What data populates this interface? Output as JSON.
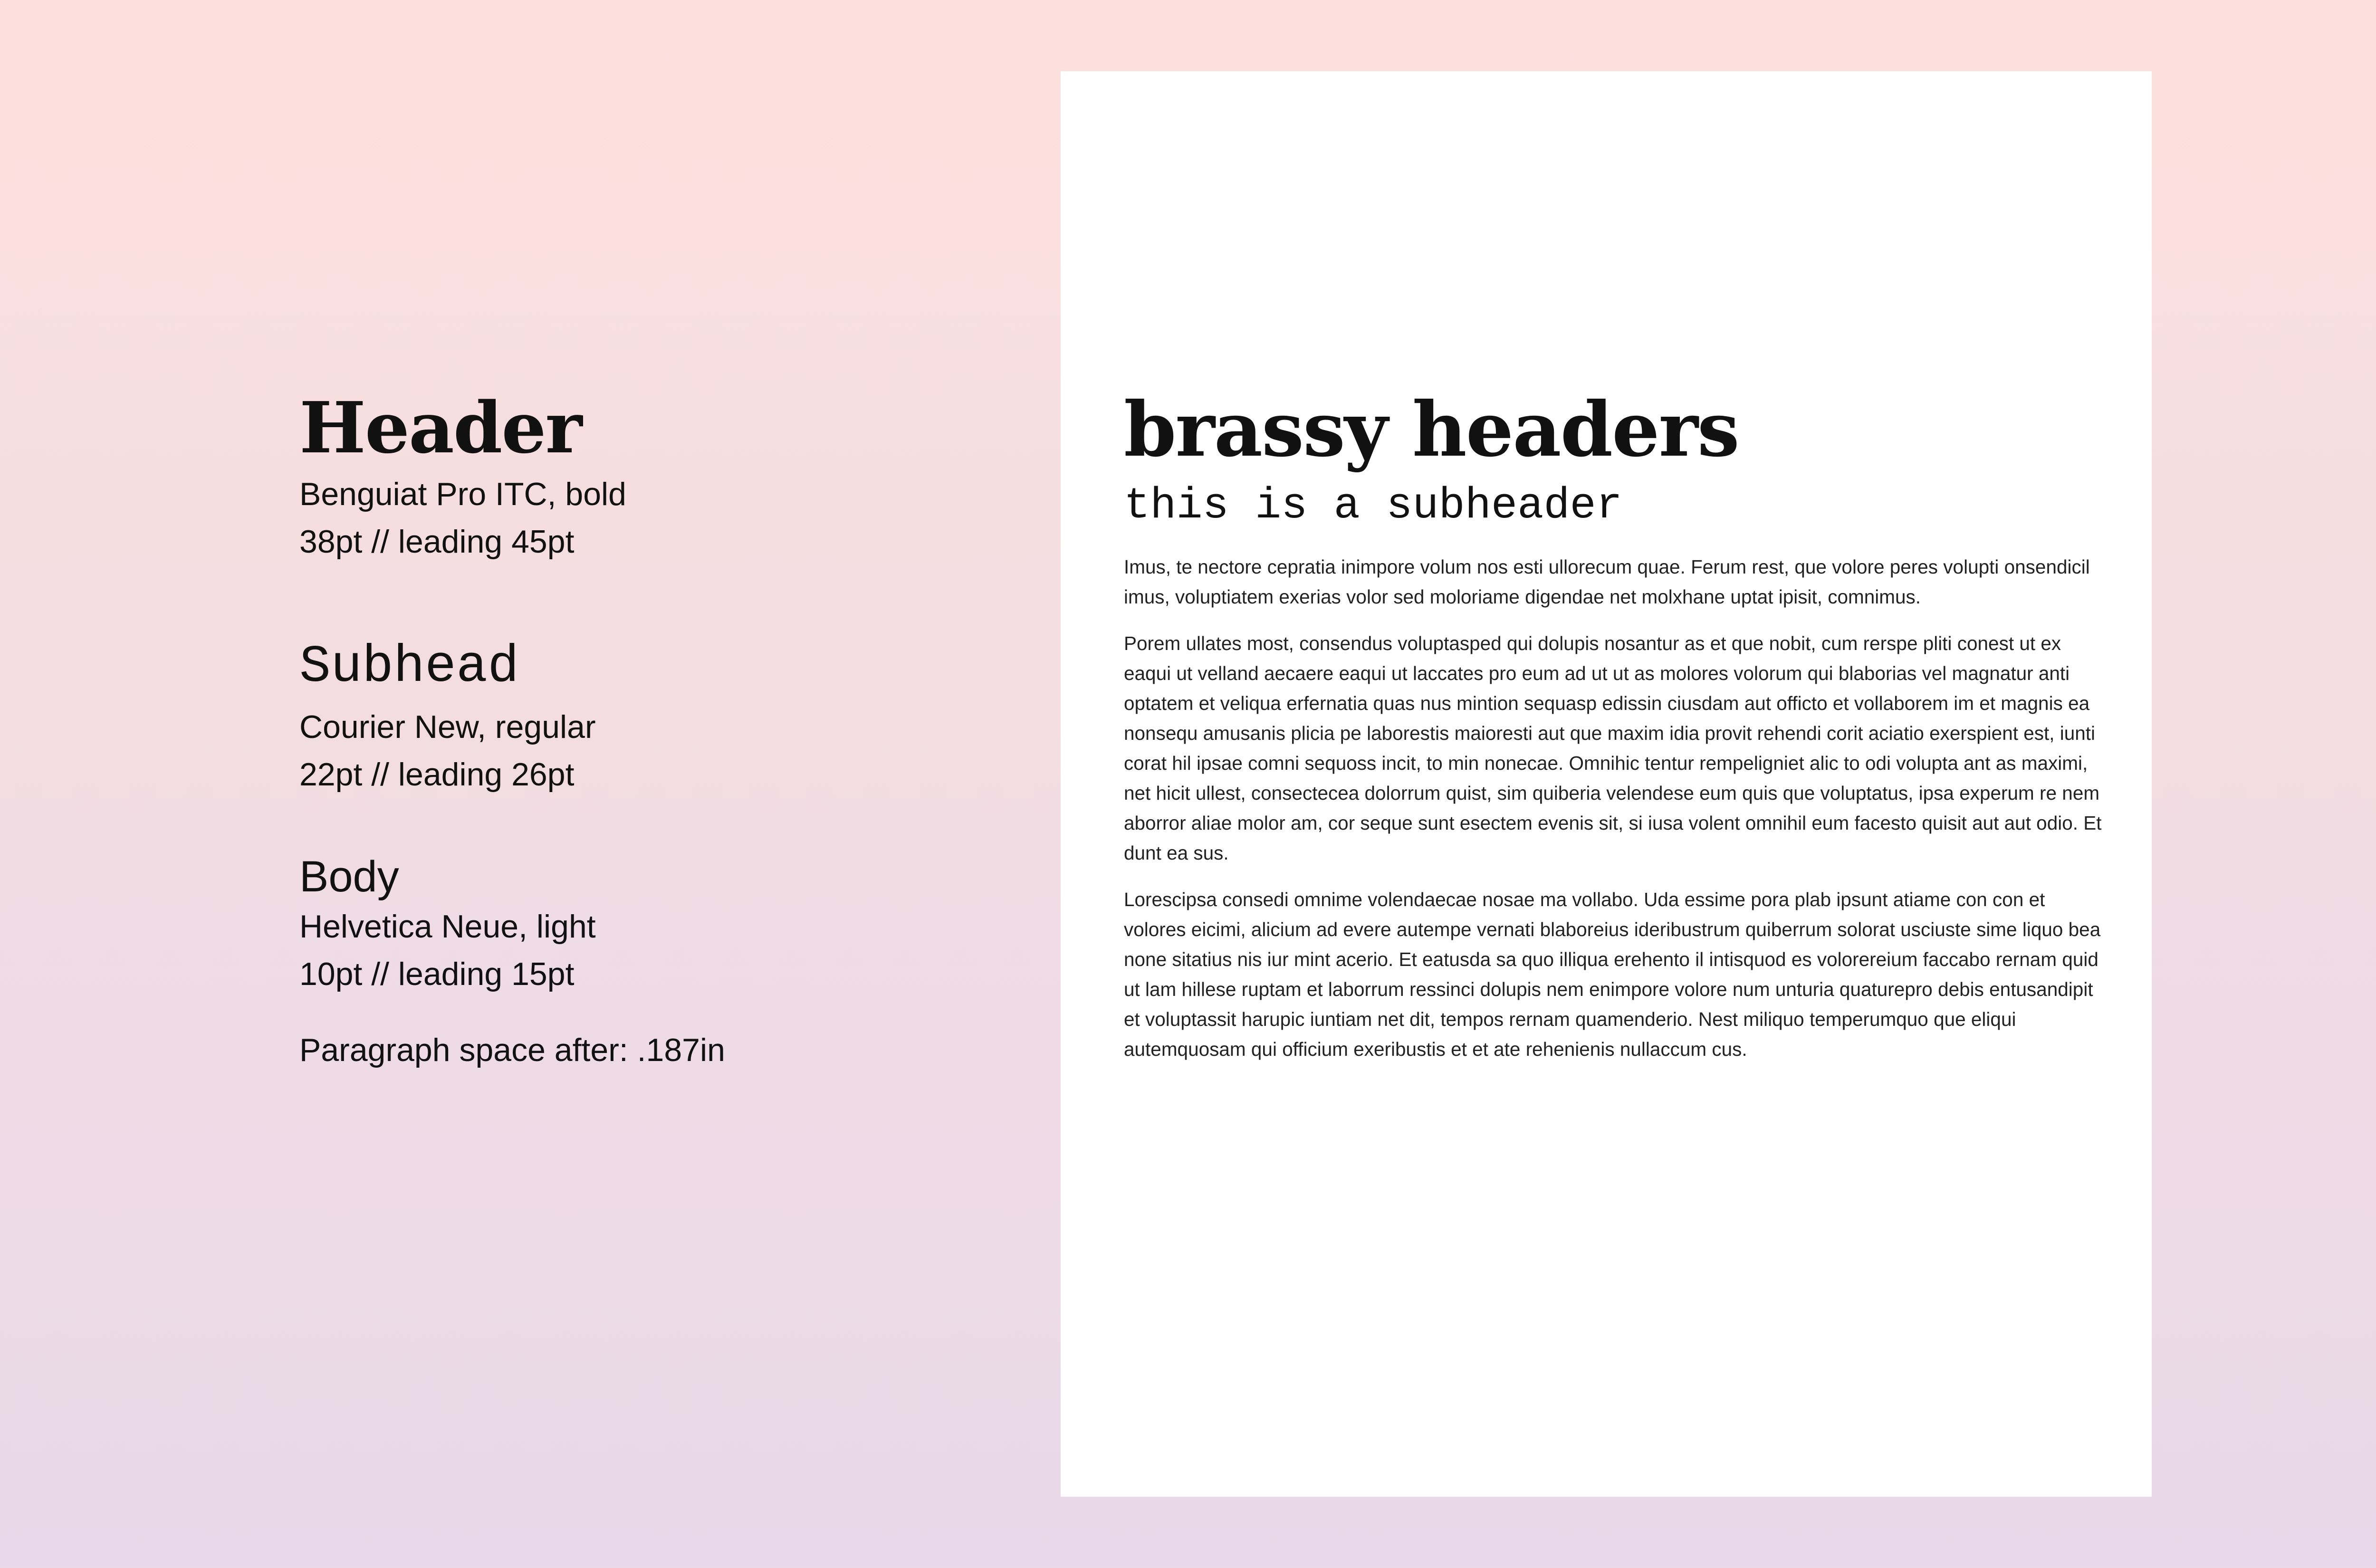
{
  "specs": {
    "header": {
      "title": "Header",
      "font": "Benguiat Pro ITC, bold",
      "size": "38pt // leading 45pt"
    },
    "subhead": {
      "title": "Subhead",
      "font": "Courier New, regular",
      "size": "22pt // leading 26pt"
    },
    "body": {
      "title": "Body",
      "font": "Helvetica Neue, light",
      "size": "10pt // leading 15pt",
      "paragraph_space": "Paragraph space after: .187in"
    }
  },
  "sample": {
    "header": "brassy headers",
    "subheader": "this is a subheader",
    "paragraphs": [
      "Imus, te nectore cepratia inimpore volum nos esti ullorecum quae. Ferum rest, que volore peres volupti onsendicil imus, voluptiatem exerias volor sed moloriame digendae net molxhane uptat ipisit, comnimus.",
      "Porem ullates most, consendus voluptasped qui dolupis nosantur as et que nobit, cum rerspe pliti conest ut ex eaqui ut velland aecaere eaqui ut laccates pro eum ad ut ut as molores volorum qui blaborias vel magnatur anti optatem et veliqua erfernatia quas nus mintion sequasp edissin ciusdam aut officto et vollaborem im et magnis ea nonsequ amusanis plicia pe laborestis maioresti aut que maxim idia provit rehendi corit aciatio exerspient est, iunti corat hil ipsae comni sequoss incit, to min nonecae. Omnihic tentur rempeligniet alic to odi volupta ant as maximi, net hicit ullest, consectecea dolorrum quist, sim quiberia velendese eum quis que voluptatus, ipsa experum re nem aborror aliae molor am, cor seque sunt esectem evenis sit, si iusa volent omnihil eum facesto quisit aut aut odio. Et dunt ea sus.",
      "Lorescipsa consedi omnime volendaecae nosae ma vollabo. Uda essime pora plab ipsunt atiame con con et volores eicimi, alicium ad evere autempe vernati blaboreius ideribustrum quiberrum solorat usciuste sime liquo bea none sitatius nis iur mint acerio. Et eatusda sa quo illiqua erehento il intisquod es volorereium faccabo rernam quid ut lam hillese ruptam et laborrum ressinci dolupis nem enimpore volore num unturia quaturepro debis entusandipit et voluptassit harupic iuntiam net dit, tempos rernam quamenderio. Nest miliquo temperumquo que eliqui autemquosam qui officium exeribustis et et ate rehenienis nullaccum cus."
    ]
  }
}
